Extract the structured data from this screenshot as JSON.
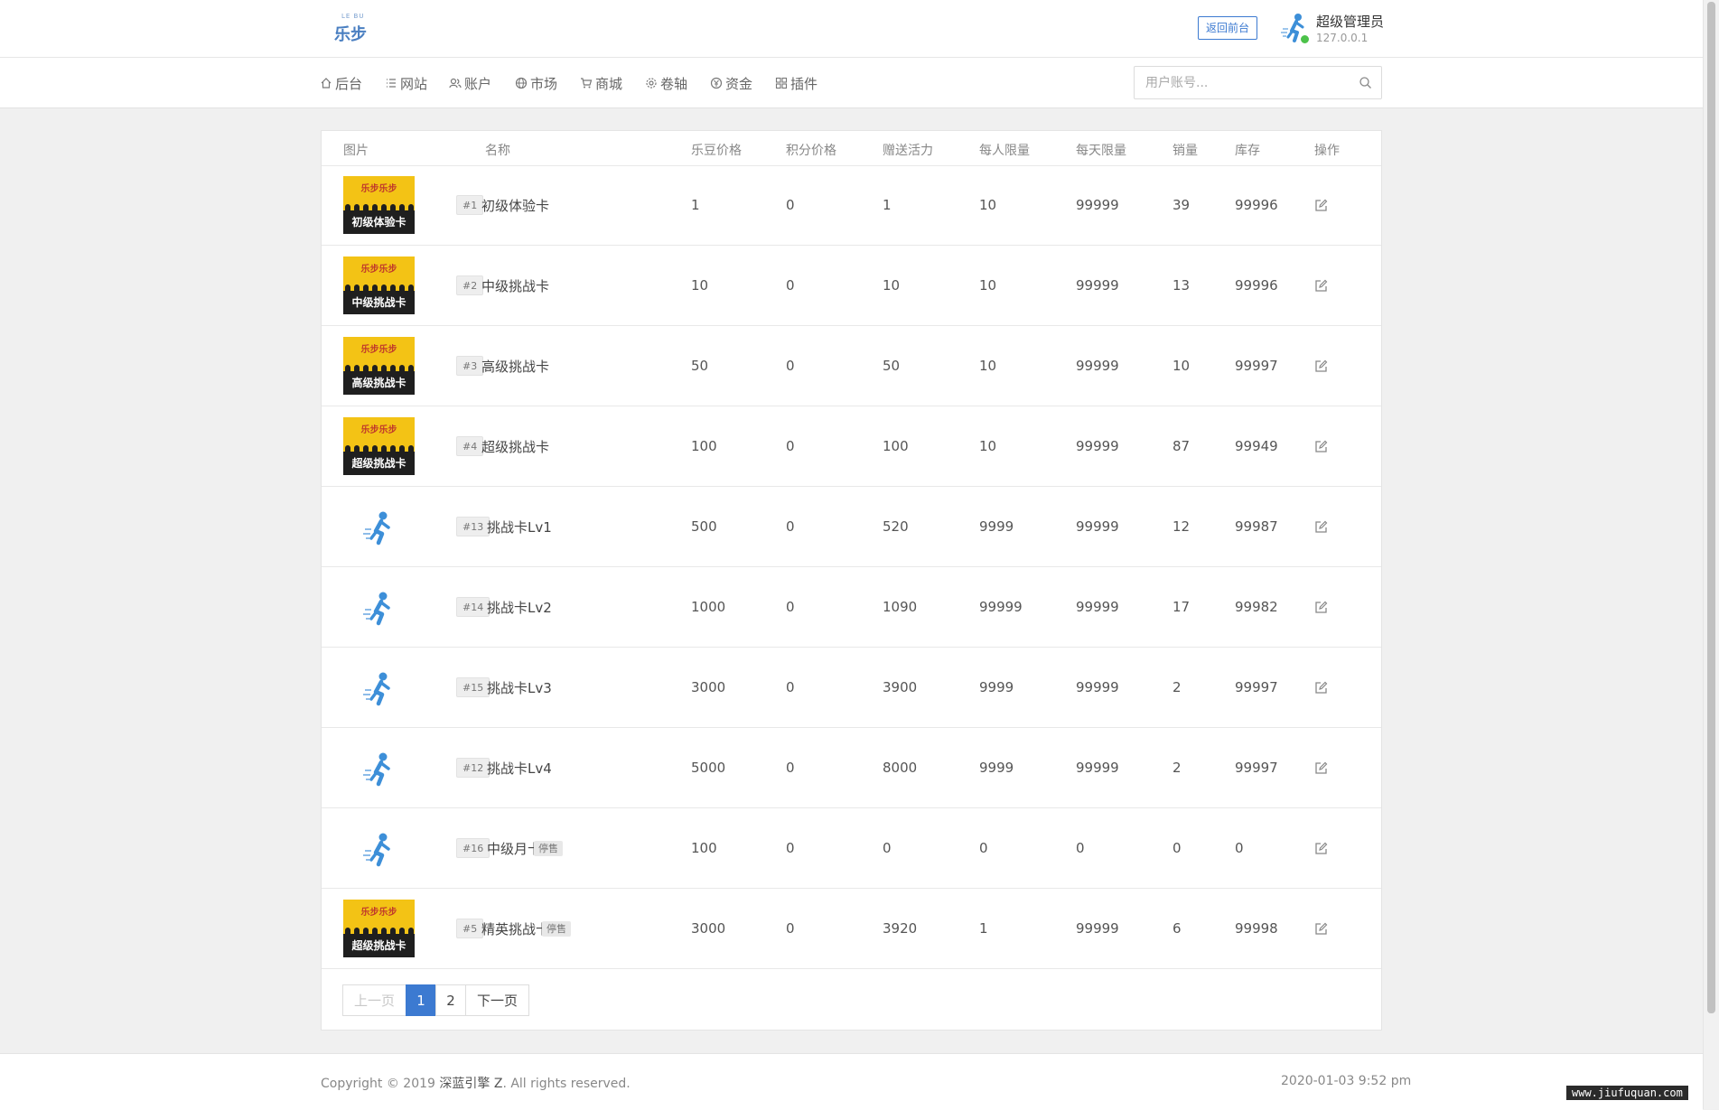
{
  "header": {
    "logo_small": "LE BU",
    "logo_text": "乐步",
    "back_button": "返回前台",
    "user_name": "超级管理员",
    "user_ip": "127.0.0.1"
  },
  "nav": {
    "items": [
      {
        "label": "后台",
        "icon": "home-icon"
      },
      {
        "label": "网站",
        "icon": "list-icon"
      },
      {
        "label": "账户",
        "icon": "users-icon"
      },
      {
        "label": "市场",
        "icon": "globe-icon"
      },
      {
        "label": "商城",
        "icon": "cart-icon"
      },
      {
        "label": "卷轴",
        "icon": "gear-icon"
      },
      {
        "label": "资金",
        "icon": "yen-icon"
      },
      {
        "label": "插件",
        "icon": "grid-icon"
      }
    ],
    "search_placeholder": "用户账号..."
  },
  "table": {
    "headers": [
      "图片",
      "名称",
      "乐豆价格",
      "积分价格",
      "赠送活力",
      "每人限量",
      "每天限量",
      "销量",
      "库存",
      "操作"
    ],
    "rows": [
      {
        "image": "card",
        "card_label": "初级体验卡",
        "id": "#1",
        "name": "初级体验卡",
        "status": "",
        "price": "1",
        "points": "0",
        "bonus": "1",
        "per_user": "10",
        "per_day": "99999",
        "sales": "39",
        "stock": "99996"
      },
      {
        "image": "card",
        "card_label": "中级挑战卡",
        "id": "#2",
        "name": "中级挑战卡",
        "status": "",
        "price": "10",
        "points": "0",
        "bonus": "10",
        "per_user": "10",
        "per_day": "99999",
        "sales": "13",
        "stock": "99996"
      },
      {
        "image": "card",
        "card_label": "高级挑战卡",
        "id": "#3",
        "name": "高级挑战卡",
        "status": "",
        "price": "50",
        "points": "0",
        "bonus": "50",
        "per_user": "10",
        "per_day": "99999",
        "sales": "10",
        "stock": "99997"
      },
      {
        "image": "card",
        "card_label": "超级挑战卡",
        "id": "#4",
        "name": "超级挑战卡",
        "status": "",
        "price": "100",
        "points": "0",
        "bonus": "100",
        "per_user": "10",
        "per_day": "99999",
        "sales": "87",
        "stock": "99949"
      },
      {
        "image": "runner",
        "card_label": "",
        "id": "#13",
        "name": "挑战卡Lv1",
        "status": "",
        "price": "500",
        "points": "0",
        "bonus": "520",
        "per_user": "9999",
        "per_day": "99999",
        "sales": "12",
        "stock": "99987"
      },
      {
        "image": "runner",
        "card_label": "",
        "id": "#14",
        "name": "挑战卡Lv2",
        "status": "",
        "price": "1000",
        "points": "0",
        "bonus": "1090",
        "per_user": "99999",
        "per_day": "99999",
        "sales": "17",
        "stock": "99982"
      },
      {
        "image": "runner",
        "card_label": "",
        "id": "#15",
        "name": "挑战卡Lv3",
        "status": "",
        "price": "3000",
        "points": "0",
        "bonus": "3900",
        "per_user": "9999",
        "per_day": "99999",
        "sales": "2",
        "stock": "99997"
      },
      {
        "image": "runner",
        "card_label": "",
        "id": "#12",
        "name": "挑战卡Lv4",
        "status": "",
        "price": "5000",
        "points": "0",
        "bonus": "8000",
        "per_user": "9999",
        "per_day": "99999",
        "sales": "2",
        "stock": "99997"
      },
      {
        "image": "runner",
        "card_label": "",
        "id": "#16",
        "name": "中级月卡",
        "status": "停售",
        "price": "100",
        "points": "0",
        "bonus": "0",
        "per_user": "0",
        "per_day": "0",
        "sales": "0",
        "stock": "0"
      },
      {
        "image": "card",
        "card_label": "超级挑战卡",
        "id": "#5",
        "name": "精英挑战卡",
        "status": "停售",
        "price": "3000",
        "points": "0",
        "bonus": "3920",
        "per_user": "1",
        "per_day": "99999",
        "sales": "6",
        "stock": "99998"
      }
    ]
  },
  "pagination": {
    "prev": "上一页",
    "pages": [
      "1",
      "2"
    ],
    "current": "1",
    "next": "下一页"
  },
  "footer": {
    "copyright_prefix": "Copyright © 2019 ",
    "copyright_brand": "深蓝引擎 Z",
    "copyright_suffix": ". All rights reserved.",
    "timestamp": "2020-01-03 9:52 pm"
  },
  "watermark": "www.jiufuquan.com",
  "colors": {
    "accent": "#3c7ad1",
    "online": "#4cc24a",
    "card_yellow": "#f3c315",
    "runner_blue": "#3d8fd8"
  }
}
